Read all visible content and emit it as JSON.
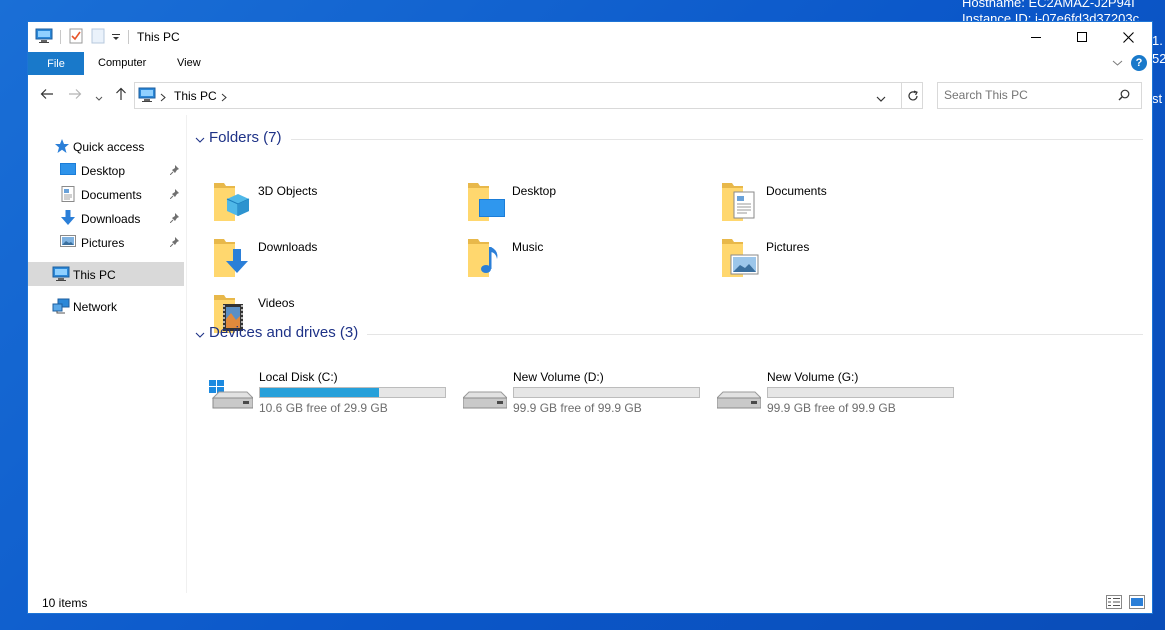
{
  "desktop": {
    "hostname_line": "Hostname: EC2AMAZ-J2P94I",
    "instance_line": "Instance ID: i-07e6fd3d37203c",
    "frag1": "1.",
    "frag2": "52",
    "frag3": "st"
  },
  "window": {
    "title": "This PC",
    "ribbon": {
      "file_tab": "File",
      "tabs": [
        "Computer",
        "View"
      ],
      "help": "?"
    },
    "address": {
      "location": "This PC"
    },
    "search": {
      "placeholder": "Search This PC"
    }
  },
  "sidebar": {
    "quick_access": "Quick access",
    "quick_items": [
      "Desktop",
      "Documents",
      "Downloads",
      "Pictures"
    ],
    "this_pc": "This PC",
    "network": "Network"
  },
  "folders": {
    "header": "Folders (7)",
    "items": [
      "3D Objects",
      "Desktop",
      "Documents",
      "Downloads",
      "Music",
      "Pictures",
      "Videos"
    ]
  },
  "drives": {
    "header": "Devices and drives (3)",
    "items": [
      {
        "name": "Local Disk (C:)",
        "free_text": "10.6 GB free of 29.9 GB",
        "used_fraction": 0.645
      },
      {
        "name": "New Volume (D:)",
        "free_text": "99.9 GB free of 99.9 GB",
        "used_fraction": 0.0
      },
      {
        "name": "New Volume (G:)",
        "free_text": "99.9 GB free of 99.9 GB",
        "used_fraction": 0.0
      }
    ]
  },
  "status": {
    "item_count": "10 items"
  },
  "colors": {
    "accent": "#1979ca",
    "drive_fill": "#26a0da",
    "folder": "#ffd76e",
    "group_title": "#1e3287"
  }
}
